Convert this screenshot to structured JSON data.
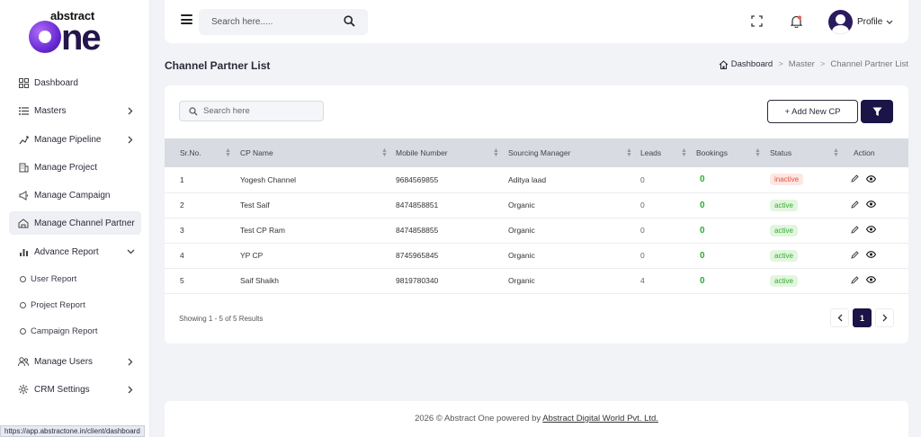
{
  "logo": {
    "small": "abstract",
    "big_rest": "ne"
  },
  "sidebar": {
    "items": [
      {
        "label": "Dashboard",
        "icon": "grid-icon",
        "active": false
      },
      {
        "label": "Masters",
        "icon": "list-icon",
        "chevron": "right"
      },
      {
        "label": "Manage Pipeline",
        "icon": "pipeline-icon",
        "chevron": "right"
      },
      {
        "label": "Manage Project",
        "icon": "building-icon"
      },
      {
        "label": "Manage Campaign",
        "icon": "megaphone-icon"
      },
      {
        "label": "Manage Channel Partner",
        "icon": "partner-icon",
        "active": true
      },
      {
        "label": "Advance Report",
        "icon": "bar-chart-icon",
        "chevron": "down"
      },
      {
        "label": "User Report",
        "sub": true
      },
      {
        "label": "Project Report",
        "sub": true
      },
      {
        "label": "Campaign Report",
        "sub": true
      },
      {
        "label": "Manage Users",
        "icon": "users-icon",
        "chevron": "right"
      },
      {
        "label": "CRM Settings",
        "icon": "gear-icon",
        "chevron": "right"
      }
    ]
  },
  "status_url": "https://app.abstractone.in/client/dashboard",
  "header": {
    "search_placeholder": "Search here.....",
    "profile_label": "Profile"
  },
  "page": {
    "title": "Channel Partner List",
    "breadcrumb": [
      "Dashboard",
      "Master",
      "Channel Partner List"
    ]
  },
  "toolbar": {
    "search_placeholder": "Search here",
    "add_label": "+ Add New CP"
  },
  "table": {
    "columns": [
      "Sr.No.",
      "CP Name",
      "Mobile Number",
      "Sourcing Manager",
      "Leads",
      "Bookings",
      "Status",
      "Action"
    ],
    "rows": [
      {
        "sr": "1",
        "name": "Yogesh Channel",
        "mobile": "9684569855",
        "manager": "Aditya laad",
        "leads": "0",
        "bookings": "0",
        "status": "inactive"
      },
      {
        "sr": "2",
        "name": "Test Saif",
        "mobile": "8474858851",
        "manager": "Organic",
        "leads": "0",
        "bookings": "0",
        "status": "active"
      },
      {
        "sr": "3",
        "name": "Test CP Ram",
        "mobile": "8474858855",
        "manager": "Organic",
        "leads": "0",
        "bookings": "0",
        "status": "active"
      },
      {
        "sr": "4",
        "name": "YP CP",
        "mobile": "8745965845",
        "manager": "Organic",
        "leads": "0",
        "bookings": "0",
        "status": "active"
      },
      {
        "sr": "5",
        "name": "Saif Shaikh",
        "mobile": "9819780340",
        "manager": "Organic",
        "leads": "4",
        "bookings": "0",
        "status": "active"
      }
    ]
  },
  "pagination": {
    "showing": "Showing 1 - 5 of 5 Results",
    "current": "1"
  },
  "footer": {
    "text": "2026 © Abstract One powered by ",
    "link": "Abstract Digital World Pvt. Ltd."
  },
  "colors": {
    "brand": "#1b1446",
    "active": "#2fae2f",
    "inactive": "#e0533f"
  }
}
